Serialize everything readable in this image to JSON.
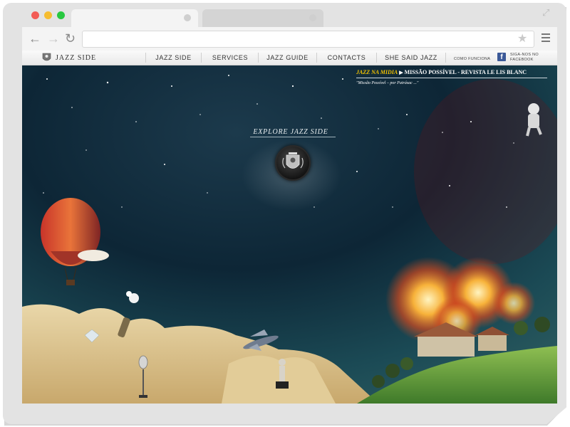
{
  "browser": {
    "traffic_lights": [
      "#f25b55",
      "#f6bd30",
      "#28c840"
    ],
    "url": "",
    "back_icon": "arrow-left-icon",
    "forward_icon": "arrow-right-icon",
    "reload_icon": "reload-icon",
    "bookmark_icon": "star-icon",
    "menu_icon": "hamburger-icon",
    "fullscreen_icon": "expand-icon"
  },
  "site": {
    "brand": "JAZZ SIDE",
    "nav": [
      "JAZZ SIDE",
      "SERVICES",
      "JAZZ GUIDE",
      "CONTACTS",
      "SHE SAID JAZZ"
    ],
    "como_funciona": "COMO FUNCIONA",
    "facebook_line1": "SIGA-NOS NO",
    "facebook_line2": "FACEBOOK",
    "facebook_glyph": "f"
  },
  "hero": {
    "news_label": "JAZZ NA MIDIA",
    "news_title": "MISSÃO POSSÍVEL - REVISTA LE LIS BLANC",
    "news_quote": "\"Missão Possível – por Patrásac ...\"",
    "explore_label": "EXPLORE JAZZ SIDE"
  }
}
